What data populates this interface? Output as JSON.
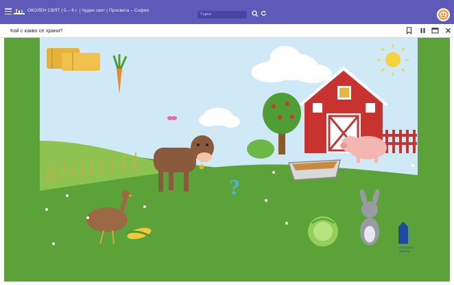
{
  "header": {
    "app_title": "ОКОЛЕН СВЯТ | 5 – 6 г. | Чуден свят | Просвета – София",
    "search_placeholder": "Търси"
  },
  "activity": {
    "question": "Кой с какво се храни?",
    "hint_symbol": "?"
  },
  "publisher": {
    "name": "ПРОСВЕТА",
    "site": "azbuki.bg"
  },
  "colors": {
    "header_bg": "#5e5ab8",
    "grass": "#5ba338",
    "sky": "#cfe9f7",
    "barn": "#c8322f",
    "question_mark": "#4bb3d9"
  },
  "icons": [
    "hamburger-icon",
    "logo-icon",
    "search-icon",
    "refresh-icon",
    "user-avatar",
    "bookmark-icon",
    "pause-icon",
    "window-icon",
    "close-icon"
  ]
}
